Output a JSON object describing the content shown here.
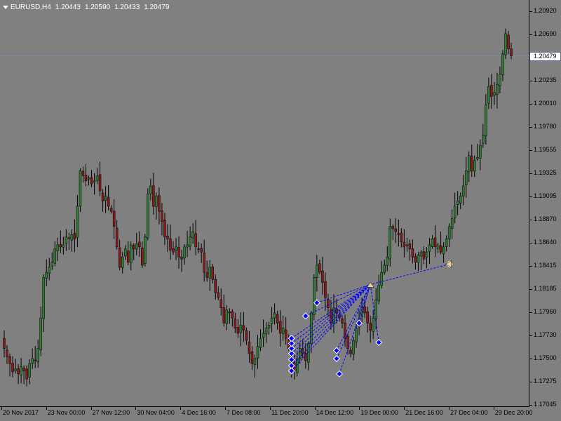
{
  "window": {
    "symbol_title": "EURUSD,H4",
    "ohlc": [
      "1.20443",
      "1.20590",
      "1.20433",
      "1.20479"
    ],
    "current_price_label": "1.20479"
  },
  "colors": {
    "background": "#808080",
    "bull_body": "#2e7d32",
    "bear_body": "#8b1a1a",
    "wick": "#000000",
    "bid_line": "#7a8ab0",
    "trade_line": "#0000ff",
    "marker": "#0000ff"
  },
  "price_axis": {
    "labels": [
      "1.20920",
      "1.20690",
      "1.20479",
      "1.20235",
      "1.20010",
      "1.19780",
      "1.19555",
      "1.19325",
      "1.19095",
      "1.18870",
      "1.18640",
      "1.18415",
      "1.18185",
      "1.17960",
      "1.17730",
      "1.17500",
      "1.17275",
      "1.17045"
    ]
  },
  "time_axis": {
    "labels": [
      "20 Nov 2017",
      "23 Nov 00:00",
      "27 Nov 12:00",
      "30 Nov 04:00",
      "4 Dec 16:00",
      "7 Dec 08:00",
      "11 Dec 20:00",
      "14 Dec 12:00",
      "19 Dec 00:00",
      "21 Dec 16:00",
      "27 Dec 04:00",
      "29 Dec 20:00"
    ]
  },
  "chart_data": {
    "type": "candlestick",
    "symbol": "EURUSD",
    "timeframe": "H4",
    "ylim": [
      1.1703,
      1.2105
    ],
    "current_price": 1.20479,
    "closes": [
      1.176,
      1.1752,
      1.1745,
      1.1737,
      1.174,
      1.1735,
      1.1742,
      1.1738,
      1.173,
      1.1745,
      1.175,
      1.1748,
      1.176,
      1.179,
      1.183,
      1.1835,
      1.184,
      1.1845,
      1.1858,
      1.1862,
      1.186,
      1.1862,
      1.187,
      1.1868,
      1.1872,
      1.1868,
      1.19,
      1.1935,
      1.193,
      1.1925,
      1.1928,
      1.1922,
      1.1925,
      1.193,
      1.1915,
      1.1905,
      1.191,
      1.19,
      1.1895,
      1.188,
      1.186,
      1.184,
      1.185,
      1.1858,
      1.1845,
      1.1862,
      1.1858,
      1.1863,
      1.186,
      1.1842,
      1.187,
      1.1912,
      1.192,
      1.19,
      1.191,
      1.1895,
      1.1885,
      1.187,
      1.1868,
      1.1857,
      1.1855,
      1.186,
      1.185,
      1.1848,
      1.186,
      1.1862,
      1.187,
      1.1875,
      1.186,
      1.1858,
      1.1855,
      1.1835,
      1.183,
      1.184,
      1.1828,
      1.1815,
      1.181,
      1.18,
      1.1785,
      1.1798,
      1.1795,
      1.179,
      1.178,
      1.1775,
      1.1783,
      1.1778,
      1.1768,
      1.1755,
      1.1745,
      1.175,
      1.1762,
      1.177,
      1.1775,
      1.178,
      1.1783,
      1.179,
      1.1795,
      1.1785,
      1.1775,
      1.178,
      1.177,
      1.176,
      1.1745,
      1.1738,
      1.175,
      1.176,
      1.1755,
      1.1748,
      1.1765,
      1.1795,
      1.183,
      1.1842,
      1.1835,
      1.1825,
      1.181,
      1.18,
      1.1785,
      1.18,
      1.1795,
      1.179,
      1.1785,
      1.177,
      1.176,
      1.1755,
      1.1768,
      1.178,
      1.179,
      1.18,
      1.1795,
      1.1785,
      1.1778,
      1.179,
      1.1808,
      1.1822,
      1.1835,
      1.1842,
      1.185,
      1.188,
      1.1878,
      1.1875,
      1.1872,
      1.1865,
      1.186,
      1.1862,
      1.1858,
      1.185,
      1.1845,
      1.1852,
      1.1855,
      1.1848,
      1.1855,
      1.1862,
      1.1868,
      1.186,
      1.1862,
      1.1855,
      1.186,
      1.1868,
      1.188,
      1.1888,
      1.19,
      1.1905,
      1.191,
      1.192,
      1.1935,
      1.195,
      1.1935,
      1.1945,
      1.1948,
      1.196,
      1.197,
      1.2,
      1.2018,
      1.2008,
      1.2012,
      1.202,
      1.203,
      1.205,
      1.207,
      1.2055,
      1.2048
    ],
    "trade_markers": [
      {
        "x_bar": 102,
        "price": 1.1749
      },
      {
        "x_bar": 102,
        "price": 1.1755
      },
      {
        "x_bar": 102,
        "price": 1.176
      },
      {
        "x_bar": 102,
        "price": 1.1765
      },
      {
        "x_bar": 102,
        "price": 1.177
      },
      {
        "x_bar": 102,
        "price": 1.1743
      },
      {
        "x_bar": 102,
        "price": 1.1738
      },
      {
        "x_bar": 107,
        "price": 1.1792
      },
      {
        "x_bar": 111,
        "price": 1.1805
      },
      {
        "x_bar": 118,
        "price": 1.175
      },
      {
        "x_bar": 118,
        "price": 1.1758
      },
      {
        "x_bar": 119,
        "price": 1.1735
      },
      {
        "x_bar": 126,
        "price": 1.1785
      },
      {
        "x_bar": 133,
        "price": 1.1766
      },
      {
        "x_bar": 158,
        "price": 1.1843
      }
    ],
    "trade_target": {
      "x_bar": 130,
      "price": 1.1823
    }
  }
}
